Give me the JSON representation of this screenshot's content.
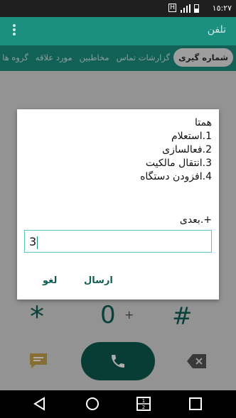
{
  "status_bar": {
    "time": "١٥:٢٧",
    "sim_badge": "H"
  },
  "app_bar": {
    "title": "تلفن"
  },
  "tabs": [
    {
      "label": "شماره گیری",
      "active": true
    },
    {
      "label": "گزارشات تماس",
      "active": false
    },
    {
      "label": "مخاطبین",
      "active": false
    },
    {
      "label": "مورد علاقه",
      "active": false
    },
    {
      "label": "گروه ها",
      "active": false
    }
  ],
  "dialog": {
    "lines": [
      "همتا",
      "1.استعلام",
      "2.فعالسازی",
      "3.انتقال مالکیت",
      "4.افزودن دستگاه"
    ],
    "next_text": "+.بعدی",
    "input_value": "3",
    "send_label": "ارسال",
    "cancel_label": "لغو"
  },
  "dialer": {
    "star": "*",
    "zero": "0",
    "plus": "+",
    "hash": "#"
  },
  "colors": {
    "accent": "#1b8f80",
    "dark_accent": "#0c5a50",
    "input_border": "#58c6b9"
  }
}
